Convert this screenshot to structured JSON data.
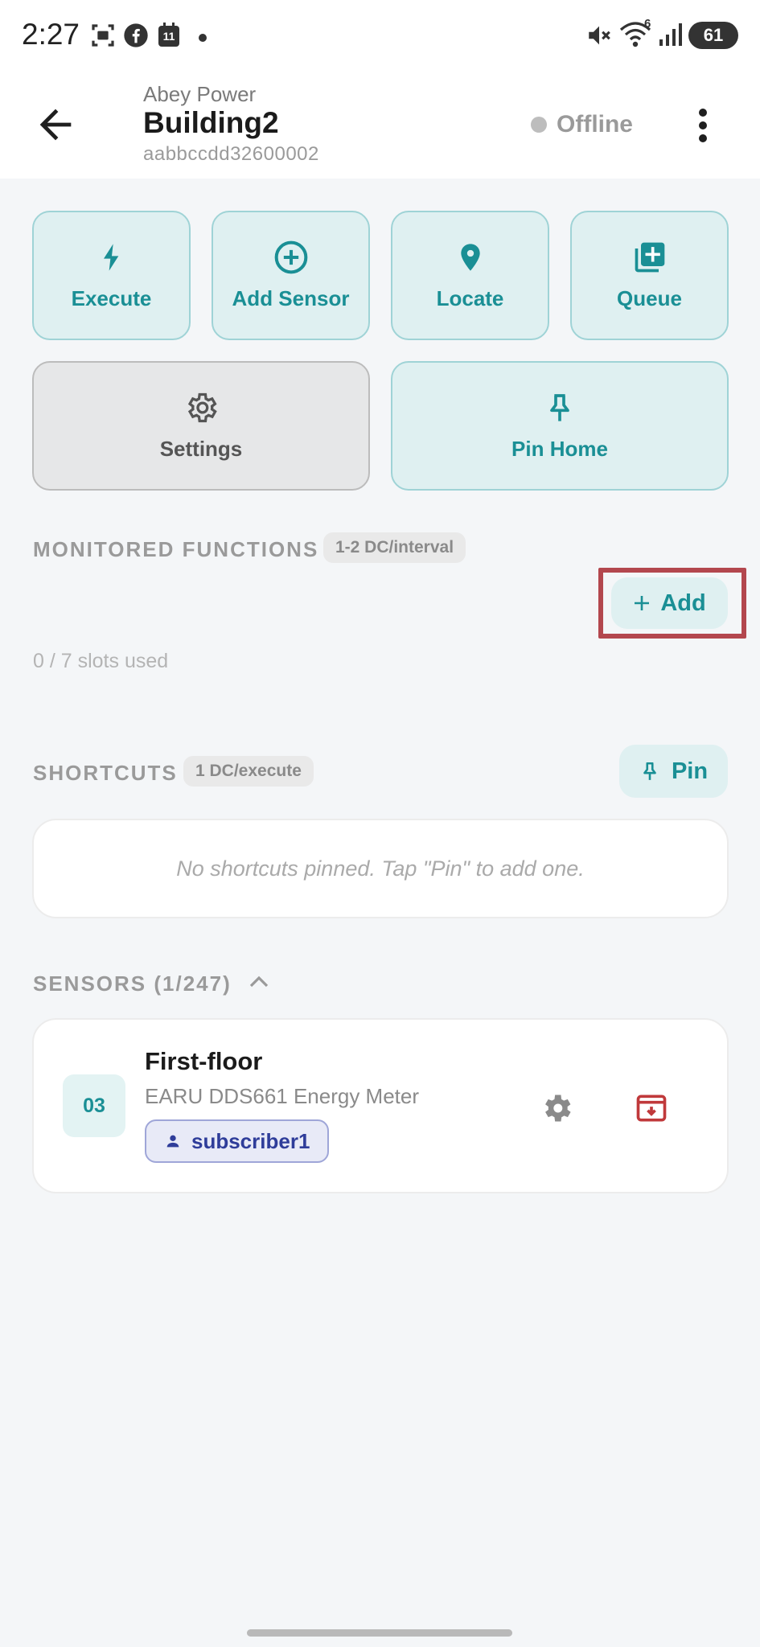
{
  "status_bar": {
    "time": "2:27",
    "notification_icons": [
      "screenshot-icon",
      "facebook-icon",
      "calendar-icon",
      "dot-icon"
    ],
    "calendar_day": "11",
    "system_icons": [
      "mute-icon",
      "wifi-icon",
      "signal-icon",
      "battery-icon"
    ],
    "wifi_badge": "6",
    "battery": "61"
  },
  "header": {
    "company": "Abey Power",
    "title": "Building2",
    "device_id": "aabbccdd32600002",
    "status": "Offline",
    "status_color": "#bdbdbd"
  },
  "actions": [
    {
      "label": "Execute",
      "icon": "bolt-icon"
    },
    {
      "label": "Add Sensor",
      "icon": "add-circle-icon"
    },
    {
      "label": "Locate",
      "icon": "location-pin-icon"
    },
    {
      "label": "Queue",
      "icon": "queue-add-icon"
    },
    {
      "label": "Settings",
      "icon": "gear-icon"
    },
    {
      "label": "Pin Home",
      "icon": "pushpin-icon"
    }
  ],
  "monitored": {
    "title": "MONITORED FUNCTIONS",
    "badge": "1-2 DC/interval",
    "add_label": "Add",
    "slots": "0 / 7 slots used"
  },
  "shortcuts": {
    "title": "SHORTCUTS",
    "badge": "1 DC/execute",
    "pin_label": "Pin",
    "empty_text": "No shortcuts pinned. Tap \"Pin\" to add one."
  },
  "sensors": {
    "title": "SENSORS (1/247)",
    "items": [
      {
        "number": "03",
        "name": "First-floor",
        "model": "EARU DDS661 Energy Meter",
        "subscriber": "subscriber1"
      }
    ]
  },
  "colors": {
    "accent": "#1a8f95",
    "accent_bg": "#dff0f1",
    "highlight": "#b3474e",
    "archive_red": "#c0393b",
    "subscriber_blue": "#2f3d9a"
  }
}
